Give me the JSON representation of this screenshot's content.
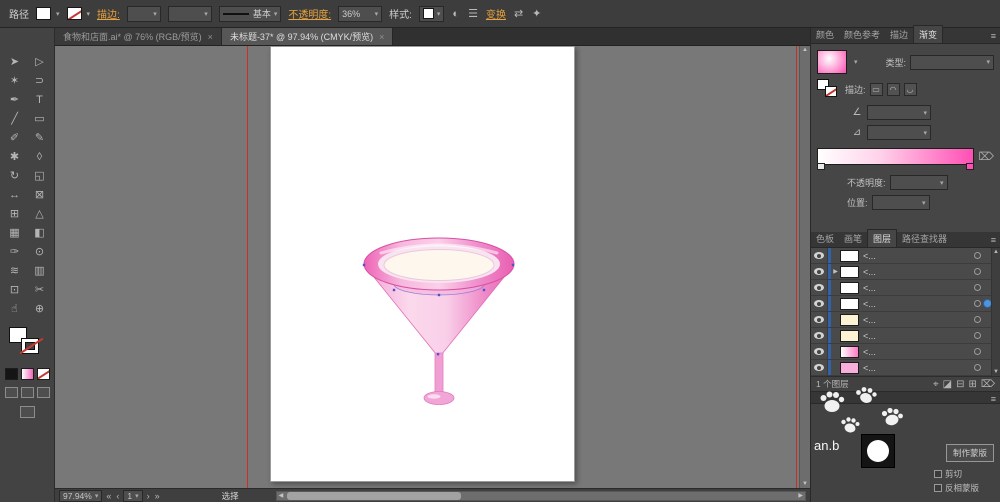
{
  "icons": {
    "chevronDown": "▾",
    "close": "×",
    "menu": "≡",
    "scrollLeft": "◀",
    "scrollRight": "▶",
    "scrollUp": "▲",
    "scrollDown": "▼",
    "firstArtboard": "«",
    "prevArtboard": "‹",
    "nextArtboard": "›",
    "lastArtboard": "»",
    "trash": "⌦",
    "angle": "∠",
    "aspectRatio": "⊿",
    "recolor": "◐",
    "align": "☰",
    "exchange": "⇄",
    "adjust": "✦"
  },
  "controlBar": {
    "objectLabel": "路径",
    "strokeLink": "描边:",
    "strokeWeight": "",
    "brushValue": "",
    "lineStyleLabel": "基本",
    "opacityLink": "不透明度:",
    "opacityValue": "36%",
    "styleLabel": "样式:",
    "transformLink": "变换"
  },
  "documentTabs": [
    {
      "label": "食物和店面.ai* @ 76% (RGB/预览)"
    },
    {
      "label": "未标题-37* @ 97.94% (CMYK/预览)"
    }
  ],
  "toolbox": {
    "tools": [
      {
        "name": "selection",
        "glyph": "➤"
      },
      {
        "name": "direct-selection",
        "glyph": "▷"
      },
      {
        "name": "magic-wand",
        "glyph": "✶"
      },
      {
        "name": "lasso",
        "glyph": "⊃"
      },
      {
        "name": "pen",
        "glyph": "✒"
      },
      {
        "name": "type",
        "glyph": "T"
      },
      {
        "name": "line-segment",
        "glyph": "╱"
      },
      {
        "name": "rectangle",
        "glyph": "▭"
      },
      {
        "name": "paintbrush",
        "glyph": "✐"
      },
      {
        "name": "pencil",
        "glyph": "✎"
      },
      {
        "name": "blob-brush",
        "glyph": "✱"
      },
      {
        "name": "eraser",
        "glyph": "◊"
      },
      {
        "name": "rotate",
        "glyph": "↻"
      },
      {
        "name": "scale",
        "glyph": "◱"
      },
      {
        "name": "width",
        "glyph": "↔"
      },
      {
        "name": "free-transform",
        "glyph": "⊠"
      },
      {
        "name": "shape-builder",
        "glyph": "⊞"
      },
      {
        "name": "perspective-grid",
        "glyph": "△"
      },
      {
        "name": "mesh",
        "glyph": "▦"
      },
      {
        "name": "gradient",
        "glyph": "◧"
      },
      {
        "name": "eyedropper",
        "glyph": "✑"
      },
      {
        "name": "blend",
        "glyph": "⊙"
      },
      {
        "name": "symbol-sprayer",
        "glyph": "≋"
      },
      {
        "name": "column-graph",
        "glyph": "▥"
      },
      {
        "name": "artboard",
        "glyph": "⊡"
      },
      {
        "name": "slice",
        "glyph": "✂"
      },
      {
        "name": "hand",
        "glyph": "☝"
      },
      {
        "name": "zoom",
        "glyph": "⊕"
      }
    ]
  },
  "gradientPanel": {
    "tabs": [
      {
        "label": "颜色"
      },
      {
        "label": "颜色参考"
      },
      {
        "label": "描边"
      },
      {
        "label": "渐变"
      }
    ],
    "typeLabel": "类型:",
    "typeValue": "",
    "strokeLabel": "描边:",
    "strokeButtons": [
      "▭",
      "◠",
      "◡"
    ],
    "angleValue": "",
    "aspectValue": "",
    "opacityLabel": "不透明度:",
    "opacityValue": "",
    "positionLabel": "位置:",
    "positionValue": "",
    "thumbStyle": "background:radial-gradient(circle at 40% 35%, #ffffff 0%, #ff9ed4 55%, #ff4cb3 100%)",
    "barStyle": "background:linear-gradient(90deg,#ffffff 0%,#ffd2ea 40%,#ff4fb4 100%)",
    "accentPink": "#ff4fb4"
  },
  "layersPanel": {
    "tabs": [
      {
        "label": "色板"
      },
      {
        "label": "画笔"
      },
      {
        "label": "图层"
      },
      {
        "label": "路径查找器"
      }
    ],
    "rows": [
      {
        "name": "<...",
        "expand": "",
        "thumb": "background:#ffffff",
        "selClass": "sel-dot"
      },
      {
        "name": "<...",
        "expand": "▶",
        "thumb": "background:#ffffff",
        "selClass": "sel-dot"
      },
      {
        "name": "<...",
        "expand": "",
        "thumb": "background:#ffffff",
        "selClass": "sel-dot"
      },
      {
        "name": "<...",
        "expand": "",
        "thumb": "background:#ffffff",
        "selClass": "sel-dot on"
      },
      {
        "name": "<...",
        "expand": "",
        "thumb": "background:#fcf3d4",
        "selClass": "sel-dot"
      },
      {
        "name": "<...",
        "expand": "",
        "thumb": "background:#fcf3d4",
        "selClass": "sel-dot"
      },
      {
        "name": "<...",
        "expand": "",
        "thumb": "background:linear-gradient(90deg,#ffffff,#ff79c4)",
        "selClass": "sel-dot"
      },
      {
        "name": "<...",
        "expand": "",
        "thumb": "background:#f7aeda",
        "selClass": "sel-dot"
      }
    ],
    "statusText": "1 个图层",
    "footerIcons": [
      {
        "name": "locate-object",
        "glyph": "⌖"
      },
      {
        "name": "make-clip-mask",
        "glyph": "◪"
      },
      {
        "name": "new-sublayer",
        "glyph": "⊟"
      },
      {
        "name": "new-layer",
        "glyph": "⊞"
      },
      {
        "name": "delete-layer",
        "glyph": "⌦"
      }
    ]
  },
  "transparencyPanel": {
    "makeMaskButton": "制作蒙版",
    "clipLabel": "剪切",
    "invertLabel": "反相蒙版"
  },
  "statusBar": {
    "zoom": "97.94%",
    "artboardNumber": "1",
    "toolStatus": "选择"
  },
  "artwork": {
    "colors": {
      "rimEdge": "#ed64b6",
      "rimLight": "#fbcfe9",
      "liquid": "#fdf7ee",
      "cone": "#f4a7d6",
      "stem": "#f19fd3",
      "outline": "#d9559f",
      "anchor": "#4f52c8"
    }
  },
  "watermark": {
    "text": "an.b"
  }
}
